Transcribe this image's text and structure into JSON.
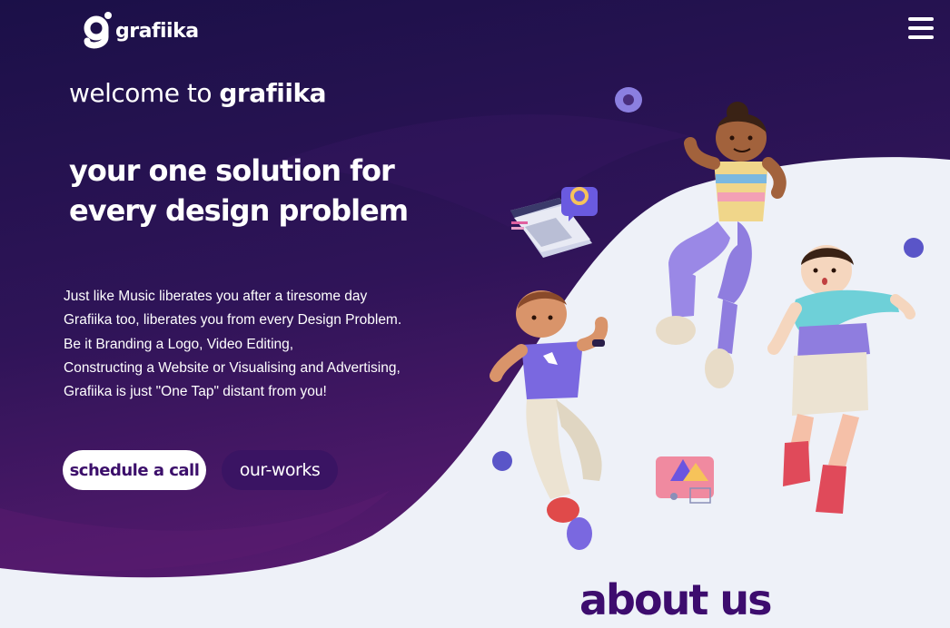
{
  "brand": {
    "name": "grafiika",
    "logo_letter": "g"
  },
  "nav": {
    "menu_icon": "hamburger-menu-icon"
  },
  "hero": {
    "welcome_prefix": "welcome to ",
    "welcome_brand": "grafiika",
    "headline_line1": "your one solution for",
    "headline_line2": "every design problem",
    "description": [
      "Just like Music liberates you after a tiresome day",
      "Grafiika too, liberates you from every Design Problem.",
      "Be it Branding a Logo, Video Editing,",
      "Constructing a Website or Visualising and Advertising,",
      "Grafiika is just \"One Tap\" distant from you!"
    ],
    "primary_button": "schedule a call",
    "secondary_button": "our-works"
  },
  "about": {
    "title": "about us"
  },
  "colors": {
    "hero_dark": "#1d0f4a",
    "hero_purple": "#4a1866",
    "light_bg": "#eef1f8",
    "accent_text": "#3d0c6e"
  }
}
